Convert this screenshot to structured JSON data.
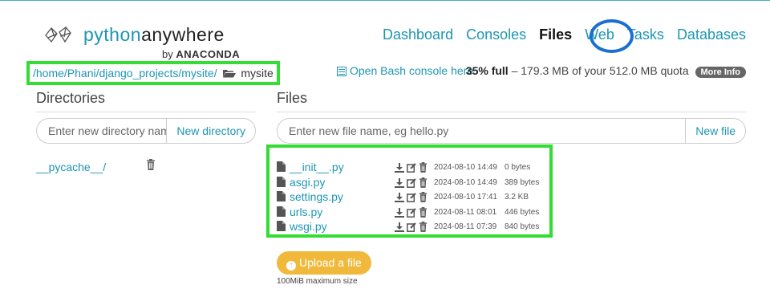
{
  "logo": {
    "python": "python",
    "anywhere": "anywhere",
    "by": "by",
    "anaconda": "ANACONDA"
  },
  "nav": {
    "items": [
      "Dashboard",
      "Consoles",
      "Files",
      "Web",
      "Tasks",
      "Databases"
    ],
    "active": "Files"
  },
  "breadcrumb": {
    "parts": [
      "/home",
      "/Phani",
      "/django_projects",
      "/mysite/"
    ],
    "current": "mysite"
  },
  "bash_console": "Open Bash console here",
  "quota": {
    "percent": "35% full",
    "detail": " – 179.3 MB of your 512.0 MB quota",
    "more_info": "More Info"
  },
  "directories": {
    "header": "Directories",
    "input_placeholder": "Enter new directory name",
    "button": "New directory",
    "items": [
      "__pycache__/"
    ]
  },
  "files": {
    "header": "Files",
    "input_placeholder": "Enter new file name, eg hello.py",
    "button": "New file",
    "items": [
      {
        "name": "__init__.py",
        "date": "2024-08-10 14:49",
        "size": "0 bytes"
      },
      {
        "name": "asgi.py",
        "date": "2024-08-10 14:49",
        "size": "389 bytes"
      },
      {
        "name": "settings.py",
        "date": "2024-08-10 17:41",
        "size": "3.2 KB"
      },
      {
        "name": "urls.py",
        "date": "2024-08-11 08:01",
        "size": "446 bytes"
      },
      {
        "name": "wsgi.py",
        "date": "2024-08-11 07:39",
        "size": "840 bytes"
      }
    ]
  },
  "upload": {
    "button": "Upload a file",
    "note": "100MiB maximum size"
  },
  "colors": {
    "accent": "#1d96b3",
    "highlight": "#33dd33",
    "circle": "#1a6fd1",
    "upload": "#f0b93c"
  }
}
